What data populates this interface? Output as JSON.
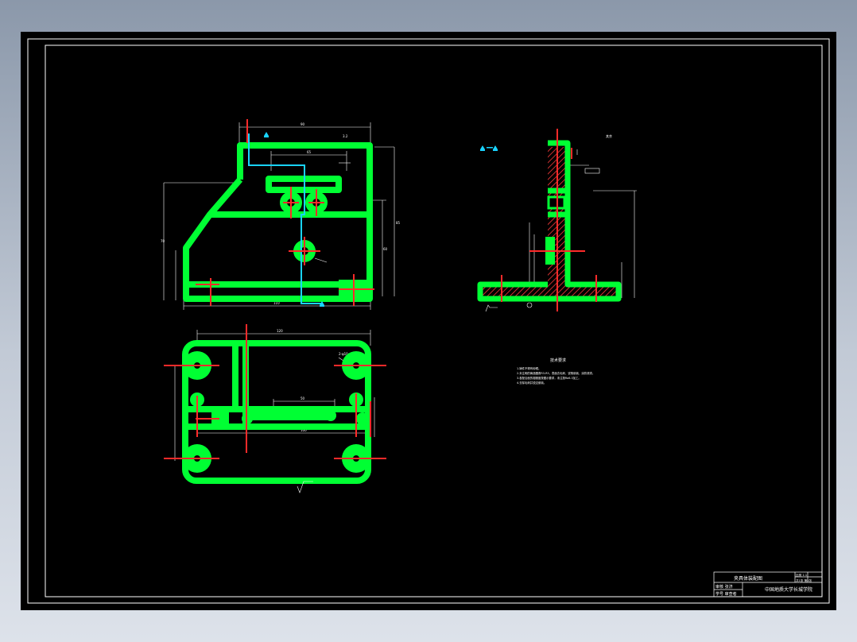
{
  "drawing": {
    "title_block": {
      "title": "夹具体装配图",
      "row1_left": "审核 张济",
      "row2_left": "学号 审查者",
      "school": "中国地质大学长城学院",
      "scale_label": "比例 1:1",
      "sheet_label": "共1张 第1张"
    },
    "technical_requirements": {
      "heading": "技术要求",
      "items": [
        "1.铸件不得有砂眼。",
        "2.未注明的铸造圆角R3-R5，表面去毛刺，锐角倒钝，涂防锈漆。",
        "3.各配合面的粗糙度按图示要求，未注按Ra6.3加工。",
        "4.去除毛刺并锐边倒钝。"
      ]
    },
    "side_view_label": "其余",
    "dimensions": {
      "top_width": "90",
      "inner_width": "65",
      "base_width": "110",
      "bottom_width": "120",
      "bottom_inner": "100",
      "height_total": "85",
      "height_mid": "60",
      "side_height": "70",
      "roughness": "3.2",
      "hole_callout": "2-φ10",
      "slot_width": "50"
    },
    "colors": {
      "body": "#00ff33",
      "centerline": "#ff2a2a",
      "hidden": "#19d3ff",
      "dim": "#ffffff",
      "frame": "#ffffff"
    }
  }
}
